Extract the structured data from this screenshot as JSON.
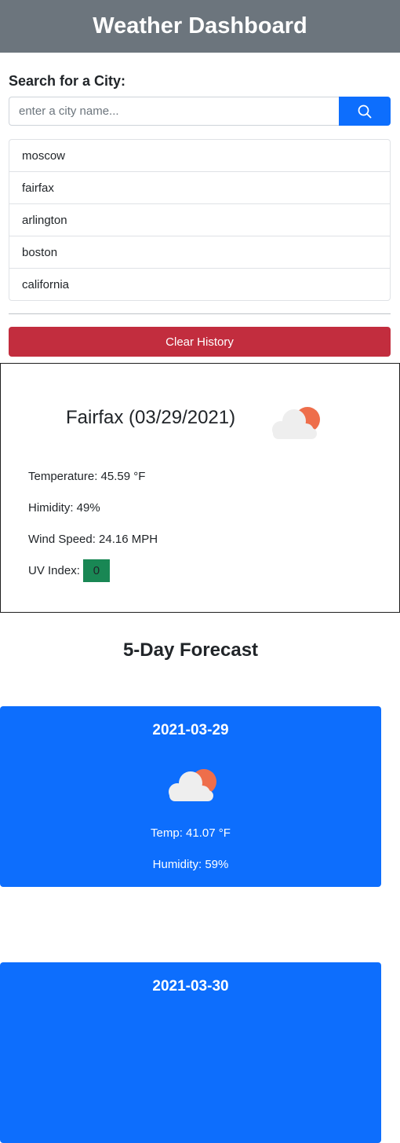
{
  "header": {
    "title": "Weather Dashboard"
  },
  "search": {
    "label": "Search for a City:",
    "placeholder": "enter a city name...",
    "value": ""
  },
  "history": [
    "moscow",
    "fairfax",
    "arlington",
    "boston",
    "california"
  ],
  "clear_button": "Clear History",
  "current": {
    "title": "Fairfax (03/29/2021)",
    "icon": "partly-cloudy-icon",
    "temperature": "Temperature: 45.59 °F",
    "humidity": "Himidity: 49%",
    "wind": "Wind Speed: 24.16 MPH",
    "uv_label": "UV Index:",
    "uv_value": "0"
  },
  "forecast": {
    "heading": "5-Day Forecast",
    "days": [
      {
        "date": "2021-03-29",
        "icon": "partly-cloudy-icon",
        "temp": "Temp: 41.07 °F",
        "humidity": "Humidity: 59%"
      },
      {
        "date": "2021-03-30",
        "icon": "",
        "temp": "",
        "humidity": ""
      }
    ]
  },
  "colors": {
    "header_bg": "#6c757d",
    "primary": "#0d6efd",
    "danger": "#c22d3e",
    "success": "#198754",
    "sun": "#ee6e4b",
    "cloud": "#eeeeee"
  }
}
